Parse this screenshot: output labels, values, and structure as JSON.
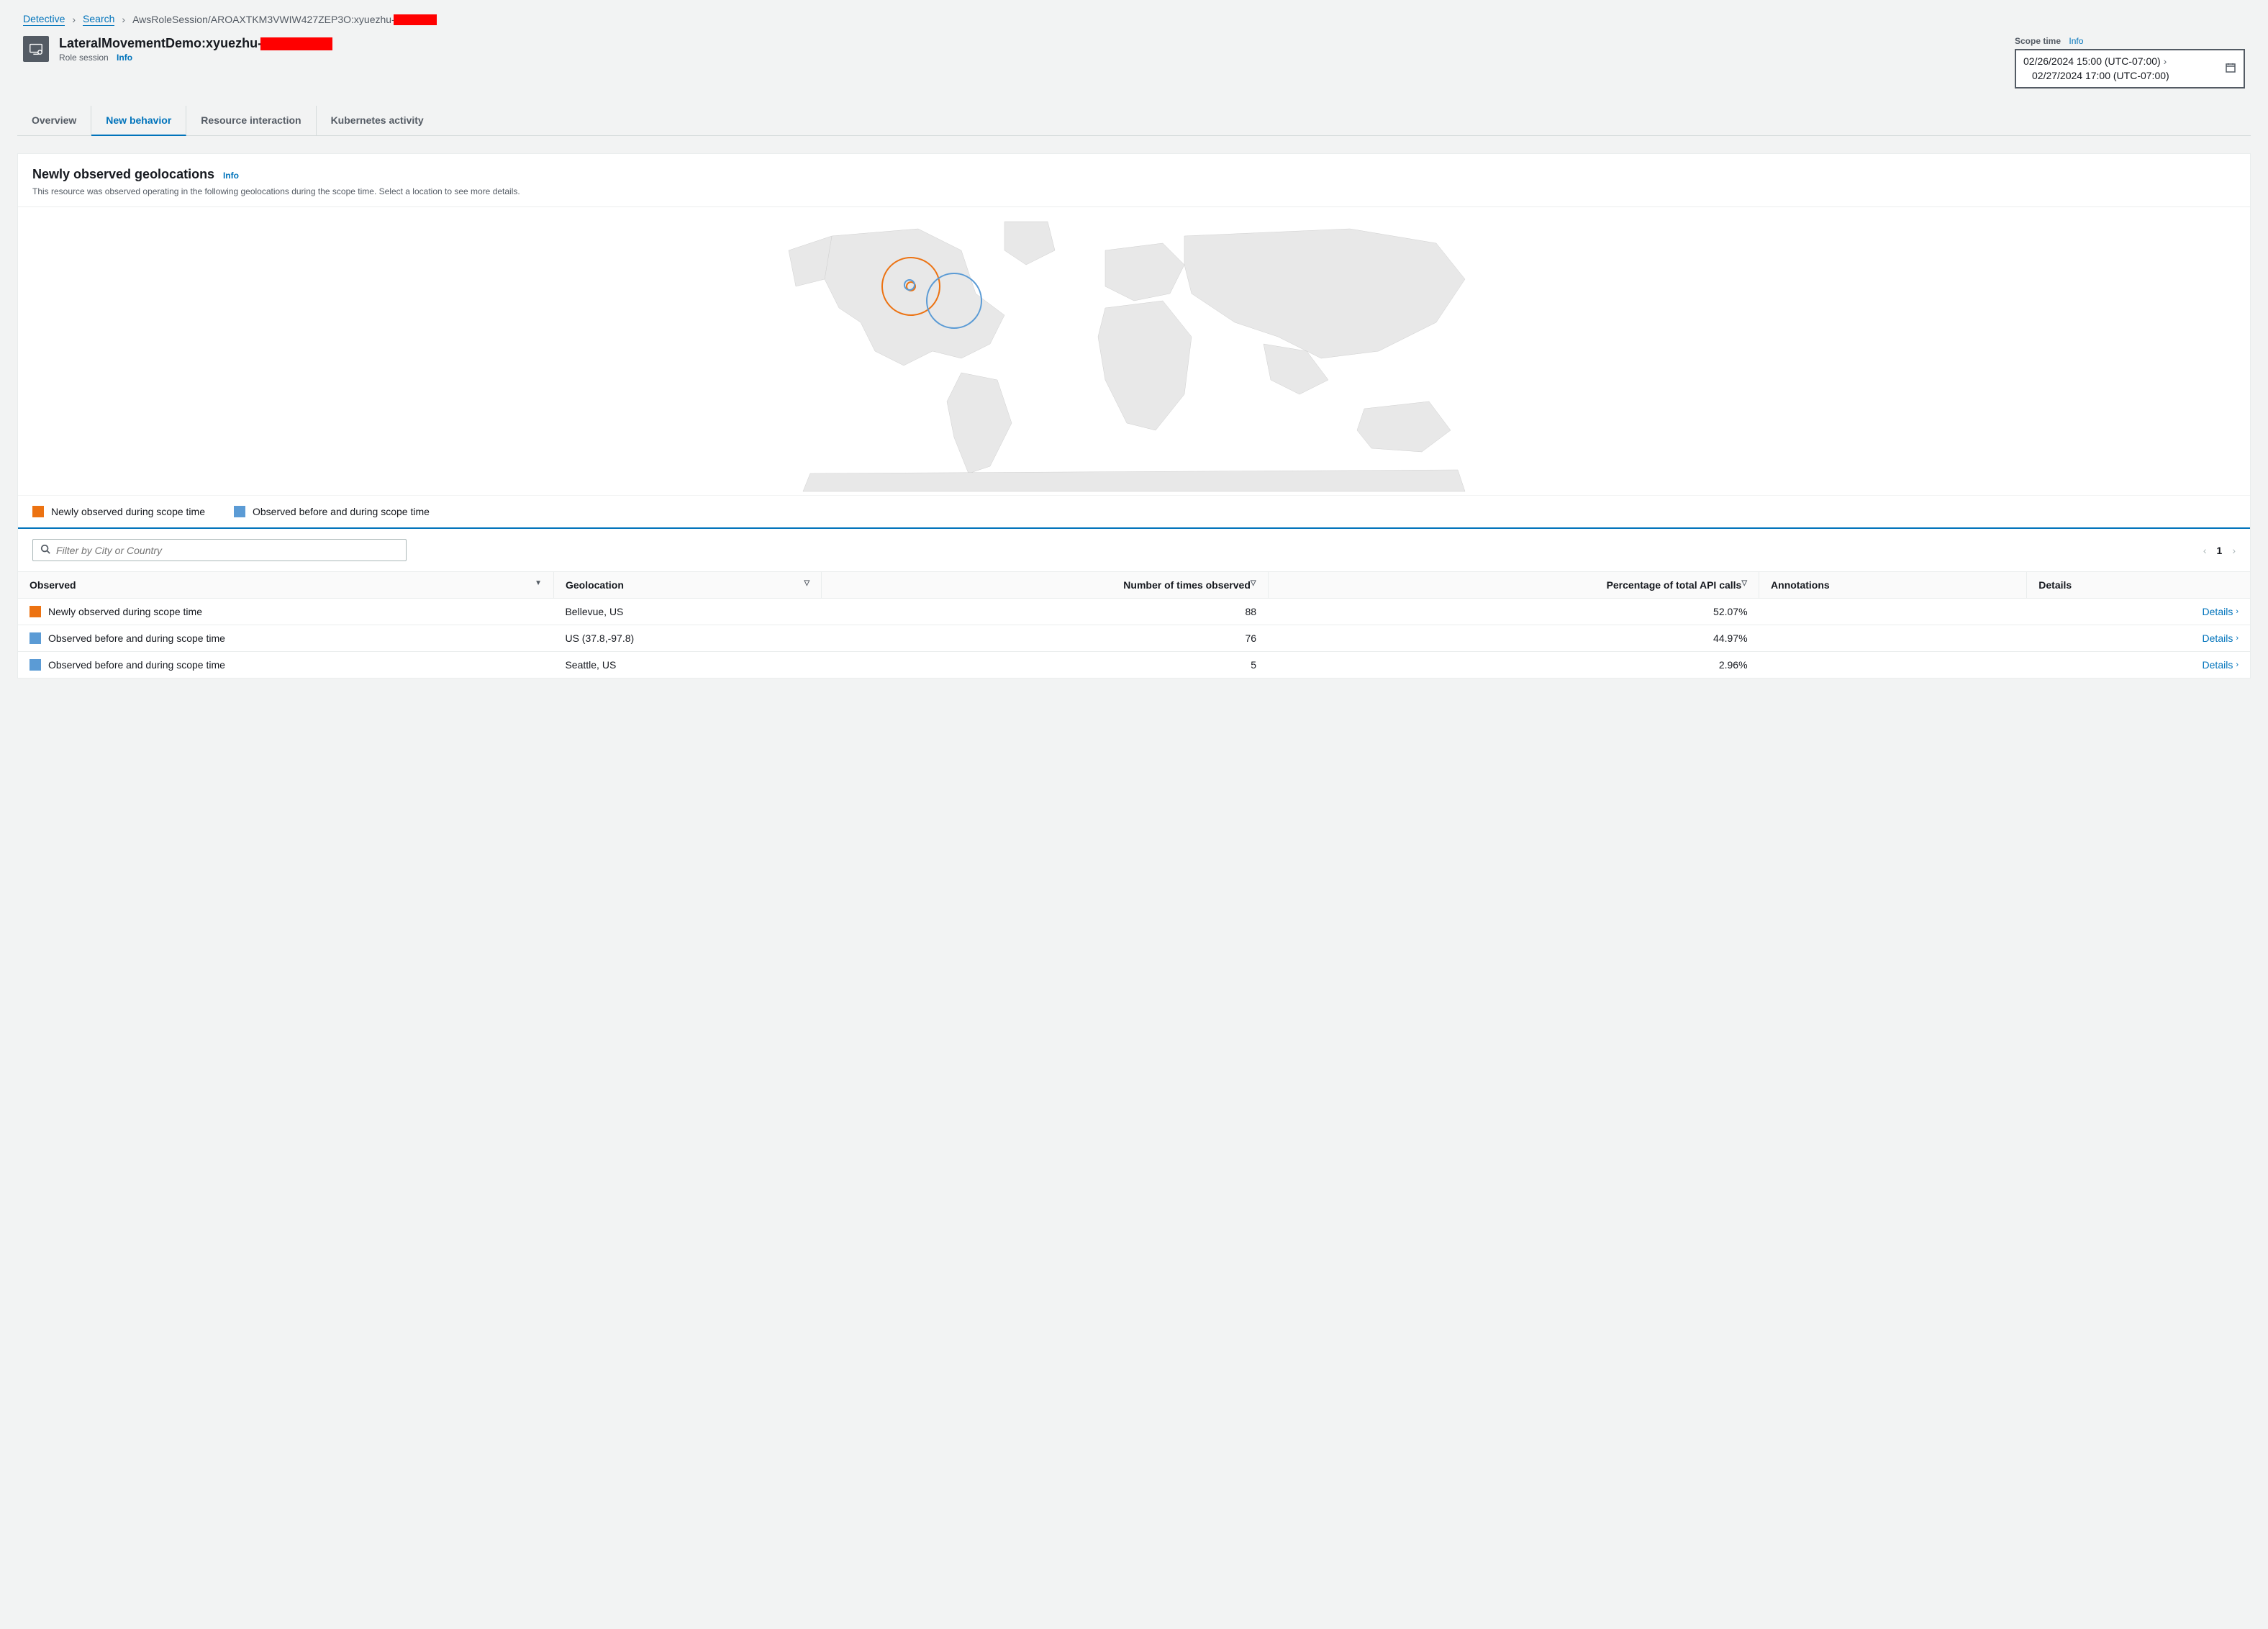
{
  "breadcrumb": {
    "root": "Detective",
    "search": "Search",
    "final_prefix": "AwsRoleSession/AROAXTKM3VWIW427ZEP3O:xyuezhu-"
  },
  "header": {
    "title_prefix": "LateralMovementDemo:xyuezhu-",
    "subtitle": "Role session",
    "info_label": "Info"
  },
  "scope": {
    "label": "Scope time",
    "info_label": "Info",
    "start": "02/26/2024 15:00 (UTC-07:00)",
    "end": "02/27/2024 17:00 (UTC-07:00)"
  },
  "tabs": {
    "overview": "Overview",
    "new_behavior": "New behavior",
    "resource_interaction": "Resource interaction",
    "kubernetes": "Kubernetes activity"
  },
  "panel": {
    "title": "Newly observed geolocations",
    "info_label": "Info",
    "description": "This resource was observed operating in the following geolocations during the scope time. Select a location to see more details."
  },
  "legend": {
    "newly": "Newly observed during scope time",
    "before": "Observed before and during scope time"
  },
  "search": {
    "placeholder": "Filter by City or Country"
  },
  "pager": {
    "page": "1"
  },
  "columns": {
    "observed": "Observed",
    "geolocation": "Geolocation",
    "times": "Number of times observed",
    "pct": "Percentage of total API calls",
    "annotations": "Annotations",
    "details": "Details"
  },
  "details_label": "Details",
  "rows": [
    {
      "swatch": "orange",
      "observed": "Newly observed during scope time",
      "geo": "Bellevue, US",
      "times": "88",
      "pct": "52.07%",
      "annotations": ""
    },
    {
      "swatch": "blue",
      "observed": "Observed before and during scope time",
      "geo": "US (37.8,-97.8)",
      "times": "76",
      "pct": "44.97%",
      "annotations": ""
    },
    {
      "swatch": "blue",
      "observed": "Observed before and during scope time",
      "geo": "Seattle, US",
      "times": "5",
      "pct": "2.96%",
      "annotations": ""
    }
  ],
  "chart_data": {
    "type": "map",
    "title": "Newly observed geolocations",
    "series": [
      {
        "name": "Newly observed during scope time",
        "color": "#ec7211",
        "points": [
          {
            "lat": 47.6,
            "lon": -122.2,
            "label": "Bellevue, US",
            "count": 88
          }
        ]
      },
      {
        "name": "Observed before and during scope time",
        "color": "#5b9bd5",
        "points": [
          {
            "lat": 37.8,
            "lon": -97.8,
            "label": "US (37.8,-97.8)",
            "count": 76
          },
          {
            "lat": 47.6,
            "lon": -122.3,
            "label": "Seattle, US",
            "count": 5
          }
        ]
      }
    ]
  }
}
